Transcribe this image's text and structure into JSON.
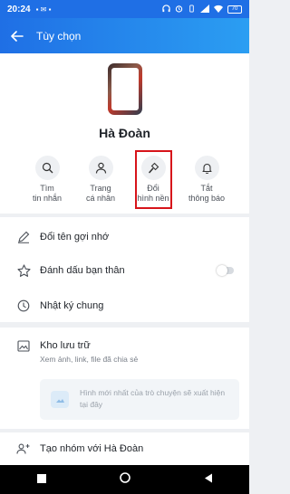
{
  "status_bar": {
    "time": "20:24",
    "battery": "70"
  },
  "app_bar": {
    "title": "Tùy chọn"
  },
  "profile": {
    "name": "Hà Đoàn"
  },
  "actions": [
    {
      "label": "Tìm\ntin nhắn"
    },
    {
      "label": "Trang\ncá nhân"
    },
    {
      "label": "Đổi\nhình nền"
    },
    {
      "label": "Tắt\nthông báo"
    }
  ],
  "options": {
    "rename": "Đổi tên gợi nhớ",
    "best_friend": "Đánh dấu bạn thân",
    "best_friend_enabled": false,
    "shared_diary": "Nhật ký chung"
  },
  "storage": {
    "title": "Kho lưu trữ",
    "subtitle": "Xem ảnh, link, file đã chia sẻ",
    "empty_text": "Hình mới nhất của trò chuyện sẽ xuất hiện tại đây"
  },
  "group": {
    "label": "Tạo nhóm với Hà Đoàn"
  },
  "colors": {
    "accent": "#1f6fe5",
    "accent_light": "#2b9ef2",
    "highlight": "#d7141a"
  }
}
